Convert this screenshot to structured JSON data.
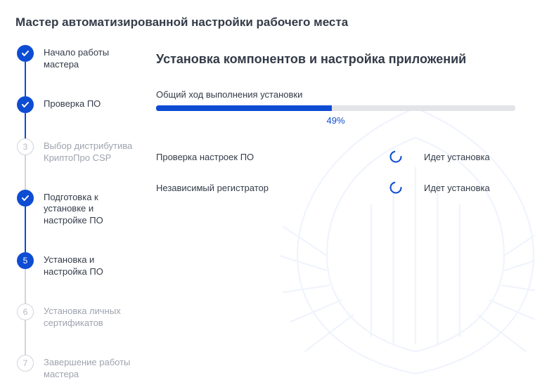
{
  "pageTitle": "Мастер автоматизированной настройки рабочего места",
  "steps": [
    {
      "label": "Начало работы мастера",
      "state": "done"
    },
    {
      "label": "Проверка ПО",
      "state": "done"
    },
    {
      "label": "Выбор дистрибутива КриптоПро CSP",
      "state": "skipped",
      "num": "3"
    },
    {
      "label": "Подготовка к установке и настройке ПО",
      "state": "done"
    },
    {
      "label": "Установка и настройка ПО",
      "state": "current",
      "num": "5"
    },
    {
      "label": "Установка личных сертификатов",
      "state": "todo",
      "num": "6"
    },
    {
      "label": "Завершение работы мастера",
      "state": "todo",
      "num": "7"
    }
  ],
  "main": {
    "sectionHeader": "Установка компонентов и настройка приложений",
    "progressLabel": "Общий ход выполнения установки",
    "progressPercent": 49,
    "progressPercentText": "49%"
  },
  "tasks": [
    {
      "name": "Проверка настроек ПО",
      "status": "Идет установка"
    },
    {
      "name": "Независимый регистратор",
      "status": "Идет установка"
    }
  ],
  "icons": {
    "check": "check-icon",
    "spinner": "spinner-icon"
  },
  "colors": {
    "accent": "#0d4cd3",
    "muted": "#9ea3ae",
    "track": "#e2e4e8"
  }
}
